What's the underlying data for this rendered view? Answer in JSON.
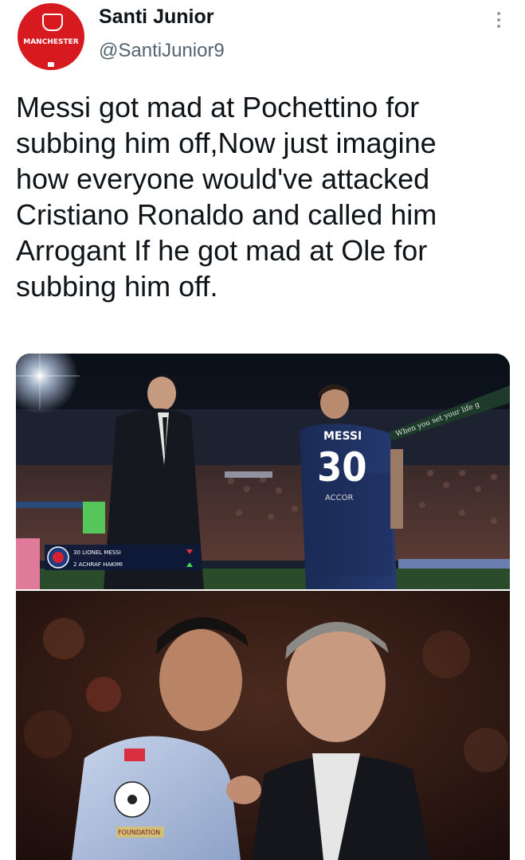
{
  "user": {
    "display_name": "Santi Junior",
    "handle": "@SantiJunior9",
    "avatar_text": "MANCHESTER"
  },
  "tweet": {
    "text": "Messi got mad at Pochettino for\nsubbing him off,Now just imagine\nhow everyone would've attacked\nCristiano Ronaldo and called him\nArrogant If he got mad at Ole for\nsubbing him off."
  },
  "media": {
    "top_photo": {
      "shirt_name": "MESSI",
      "shirt_number": "30",
      "shirt_sponsor": "ACCOR",
      "board_text": "When you set your life g",
      "sub_line_1": "30 LIONEL MESSI",
      "sub_line_2": "2 ACHRAF HAKIMI"
    },
    "bottom_photo": {
      "sleeve_text": "FOUNDATION"
    }
  },
  "icons": {
    "more": "more-vertical-icon",
    "avatar": "club-crest-avatar"
  },
  "colors": {
    "text_primary": "#0f1419",
    "text_secondary": "#536471",
    "avatar_red": "#d71a20"
  }
}
